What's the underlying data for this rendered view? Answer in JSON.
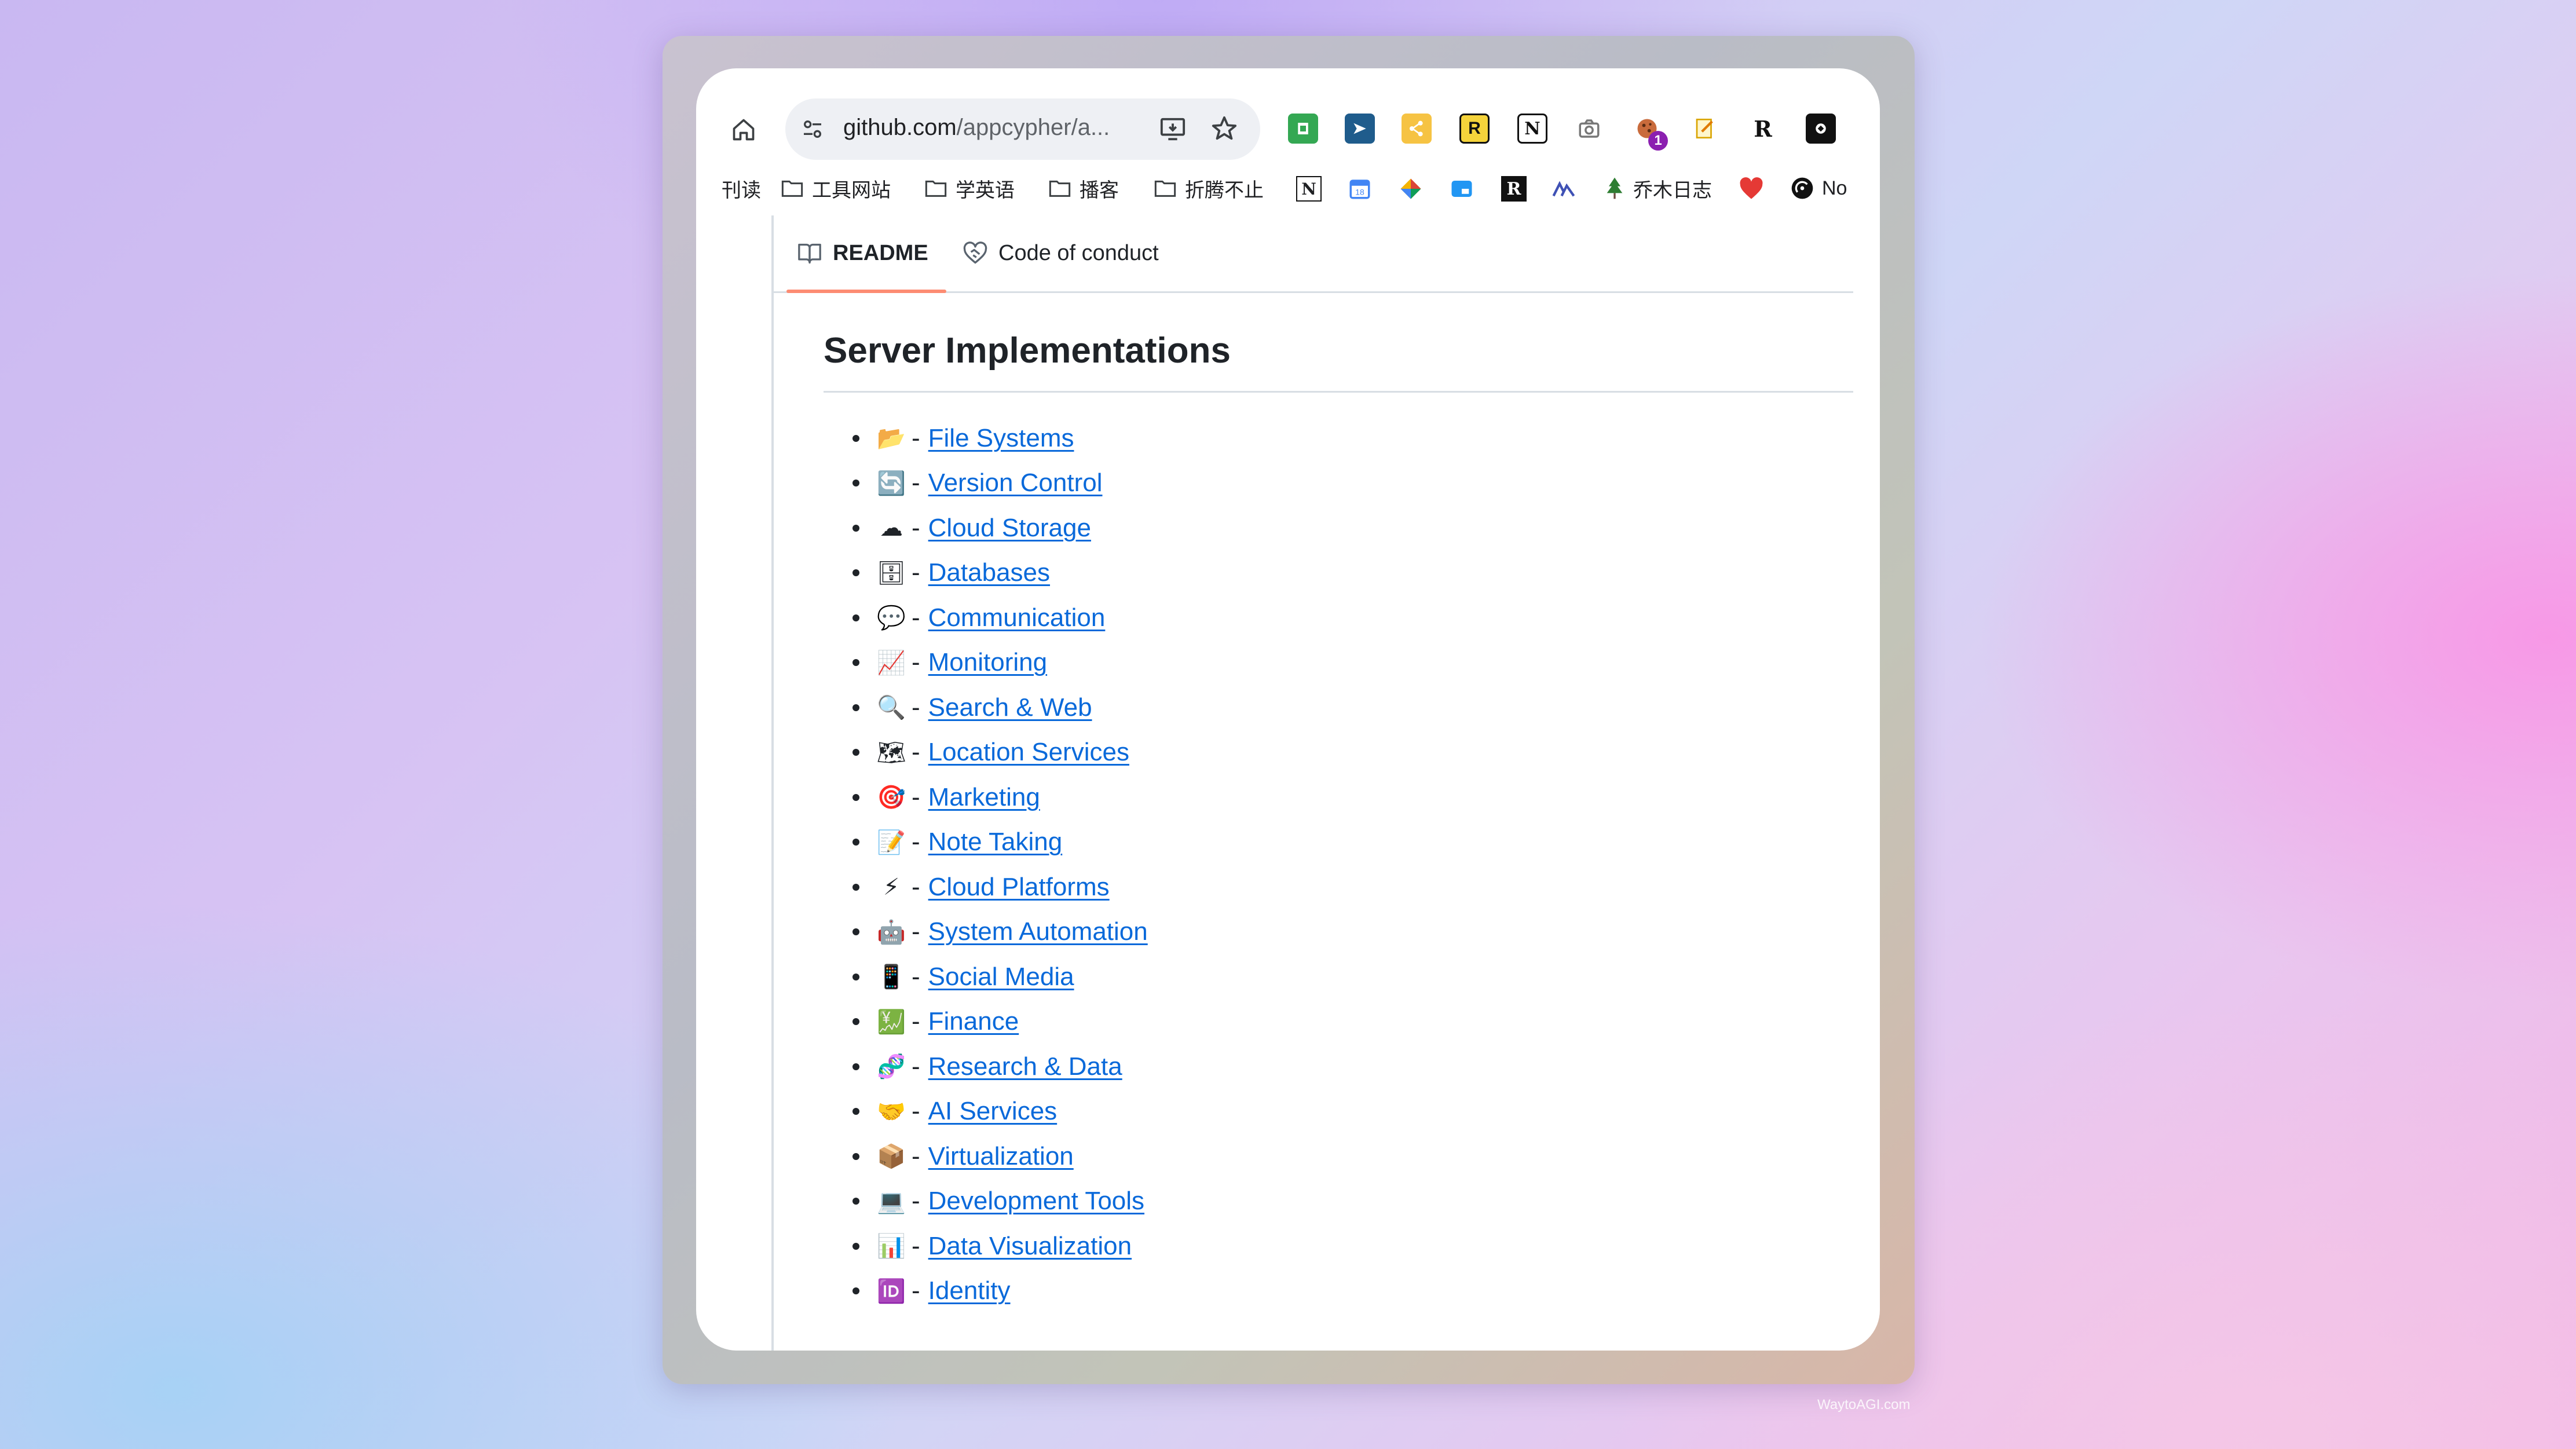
{
  "toolbar": {
    "url_host": "github.com",
    "url_path": "/appcypher/a...",
    "extension_badge": "1"
  },
  "bookmarks": [
    "刊读",
    "工具网站",
    "学英语",
    "播客",
    "折腾不止",
    "乔木日志",
    "No"
  ],
  "tabs": {
    "readme": "README",
    "code_of_conduct": "Code of conduct"
  },
  "section": {
    "heading": "Server Implementations"
  },
  "list": [
    {
      "emoji": "📂",
      "label": "File Systems"
    },
    {
      "emoji": "🔄",
      "label": "Version Control"
    },
    {
      "emoji": "☁",
      "label": "Cloud Storage"
    },
    {
      "emoji": "🗄",
      "label": "Databases"
    },
    {
      "emoji": "💬",
      "label": "Communication"
    },
    {
      "emoji": "📈",
      "label": "Monitoring"
    },
    {
      "emoji": "🔍",
      "label": "Search & Web"
    },
    {
      "emoji": "🗺",
      "label": "Location Services"
    },
    {
      "emoji": "🎯",
      "label": "Marketing"
    },
    {
      "emoji": "📝",
      "label": "Note Taking"
    },
    {
      "emoji": "⚡",
      "label": "Cloud Platforms"
    },
    {
      "emoji": "🤖",
      "label": "System Automation"
    },
    {
      "emoji": "📱",
      "label": "Social Media"
    },
    {
      "emoji": "💹",
      "label": "Finance"
    },
    {
      "emoji": "🧬",
      "label": "Research & Data"
    },
    {
      "emoji": "🤝",
      "label": "AI Services"
    },
    {
      "emoji": "📦",
      "label": "Virtualization"
    },
    {
      "emoji": "💻",
      "label": "Development Tools"
    },
    {
      "emoji": "📊",
      "label": "Data Visualization"
    },
    {
      "emoji": "🆔",
      "label": "Identity"
    }
  ],
  "separator": "-",
  "watermark": "WaytoAGI.com",
  "colors": {
    "link": "#0969da",
    "tab_underline": "#fd8c73",
    "text": "#1f2328"
  }
}
